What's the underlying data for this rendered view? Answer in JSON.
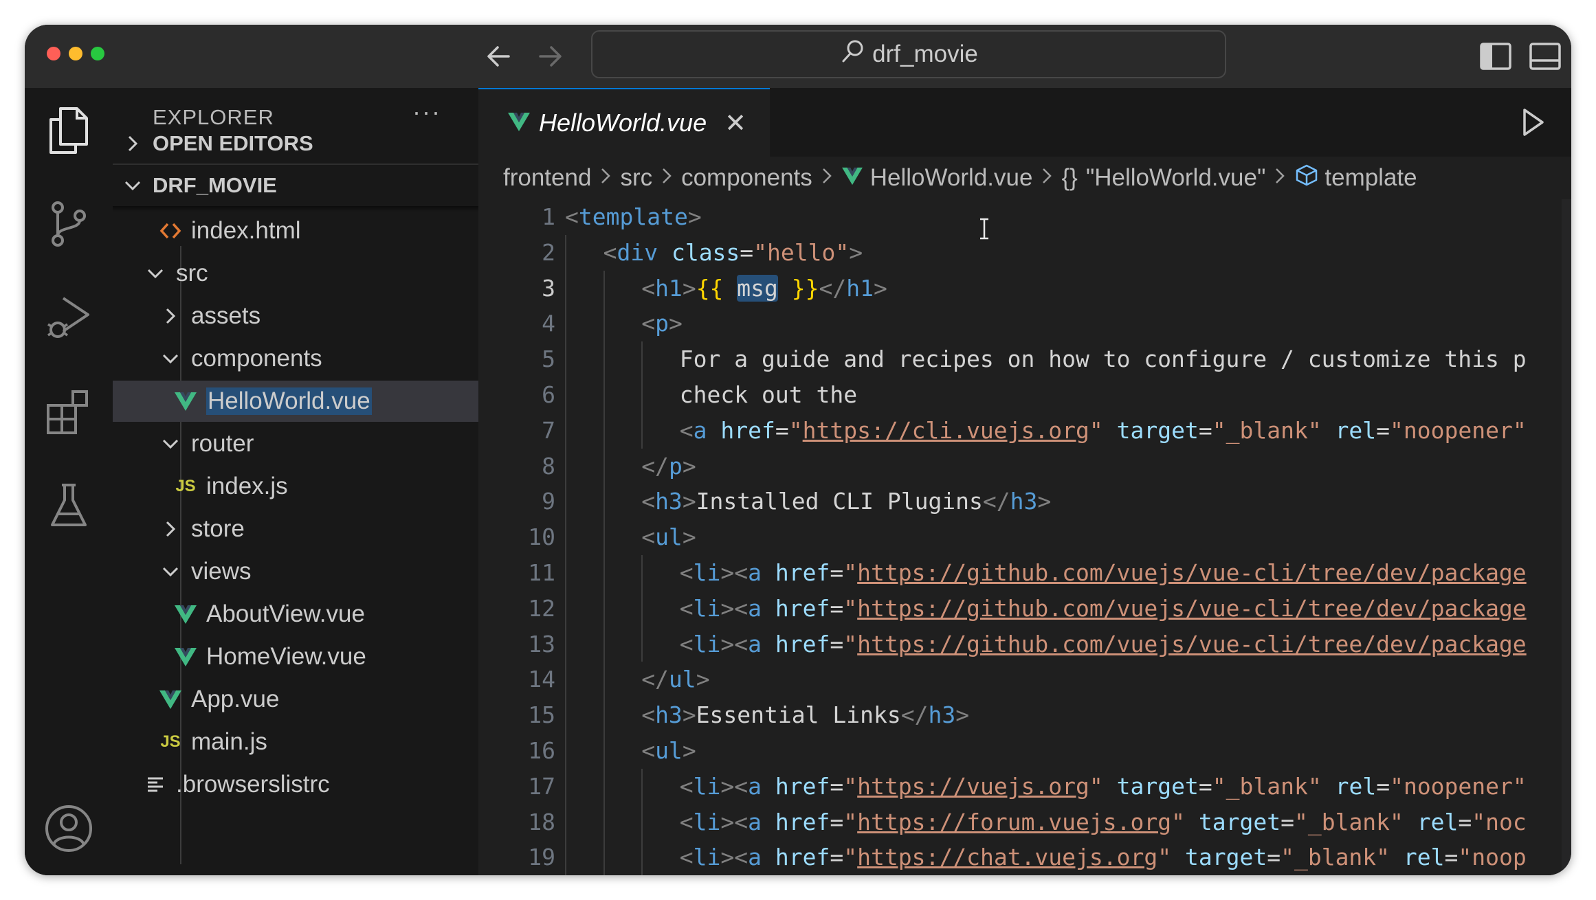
{
  "titlebar": {
    "search_text": "drf_movie"
  },
  "colors": {
    "accent": "#0078d4",
    "vue_green": "#41b883",
    "js_yellow": "#cbcb41",
    "html_orange": "#e37933",
    "selection": "#264f78"
  },
  "sidebar": {
    "title": "EXPLORER",
    "more": "···",
    "sections": [
      {
        "label": "OPEN EDITORS",
        "expanded": false
      },
      {
        "label": "DRF_MOVIE",
        "expanded": true
      }
    ],
    "tree": [
      {
        "label": "index.html",
        "icon": "html-file-icon"
      },
      {
        "label": "src",
        "icon": "chevron-down-icon"
      },
      {
        "label": "assets",
        "icon": "chevron-right-icon"
      },
      {
        "label": "components",
        "icon": "chevron-down-icon"
      },
      {
        "label": "HelloWorld.vue",
        "icon": "vue-file-icon",
        "selected": true
      },
      {
        "label": "router",
        "icon": "chevron-down-icon"
      },
      {
        "label": "index.js",
        "icon": "js-file-icon"
      },
      {
        "label": "store",
        "icon": "chevron-right-icon"
      },
      {
        "label": "views",
        "icon": "chevron-down-icon"
      },
      {
        "label": "AboutView.vue",
        "icon": "vue-file-icon"
      },
      {
        "label": "HomeView.vue",
        "icon": "vue-file-icon"
      },
      {
        "label": "App.vue",
        "icon": "vue-file-icon"
      },
      {
        "label": "main.js",
        "icon": "js-file-icon"
      },
      {
        "label": ".browserslistrc",
        "icon": "lines-file-icon"
      }
    ],
    "js_badge": "JS"
  },
  "tab": {
    "label": "HelloWorld.vue",
    "close": "✕"
  },
  "breadcrumbs": [
    "frontend",
    "src",
    "components",
    "HelloWorld.vue",
    "\"HelloWorld.vue\"",
    "template"
  ],
  "breadcrumb_braces": "{}",
  "active_line": 3,
  "code_lines": [
    {
      "n": "1",
      "t": [
        [
          "br",
          "<"
        ],
        [
          "t",
          "template"
        ],
        [
          "br",
          ">"
        ]
      ]
    },
    {
      "n": "2",
      "t": [
        [
          "br",
          "<"
        ],
        [
          "t",
          "div"
        ],
        [
          "p",
          " "
        ],
        [
          "a",
          "class"
        ],
        [
          "p",
          "="
        ],
        [
          "s",
          "\"hello\""
        ],
        [
          "br",
          ">"
        ]
      ]
    },
    {
      "n": "3",
      "t": [
        [
          "br",
          "<"
        ],
        [
          "t",
          "h1"
        ],
        [
          "br",
          ">"
        ],
        [
          "m",
          "{{ "
        ],
        [
          "hl",
          "msg"
        ],
        [
          "m",
          " }}"
        ],
        [
          "br",
          "</"
        ],
        [
          "t",
          "h1"
        ],
        [
          "br",
          ">"
        ]
      ]
    },
    {
      "n": "4",
      "t": [
        [
          "br",
          "<"
        ],
        [
          "t",
          "p"
        ],
        [
          "br",
          ">"
        ]
      ]
    },
    {
      "n": "5",
      "t": [
        [
          "p",
          "For a guide and recipes on how to configure / customize this p"
        ]
      ]
    },
    {
      "n": "6",
      "t": [
        [
          "p",
          "check out the"
        ]
      ]
    },
    {
      "n": "7",
      "t": [
        [
          "br",
          "<"
        ],
        [
          "t",
          "a"
        ],
        [
          "p",
          " "
        ],
        [
          "a",
          "href"
        ],
        [
          "p",
          "="
        ],
        [
          "s",
          "\""
        ],
        [
          "u",
          "https://cli.vuejs.org"
        ],
        [
          "s",
          "\""
        ],
        [
          "p",
          " "
        ],
        [
          "a",
          "target"
        ],
        [
          "p",
          "="
        ],
        [
          "s",
          "\"_blank\""
        ],
        [
          "p",
          " "
        ],
        [
          "a",
          "rel"
        ],
        [
          "p",
          "="
        ],
        [
          "s",
          "\"noopener\""
        ]
      ]
    },
    {
      "n": "8",
      "t": [
        [
          "br",
          "</"
        ],
        [
          "t",
          "p"
        ],
        [
          "br",
          ">"
        ]
      ]
    },
    {
      "n": "9",
      "t": [
        [
          "br",
          "<"
        ],
        [
          "t",
          "h3"
        ],
        [
          "br",
          ">"
        ],
        [
          "p",
          "Installed CLI Plugins"
        ],
        [
          "br",
          "</"
        ],
        [
          "t",
          "h3"
        ],
        [
          "br",
          ">"
        ]
      ]
    },
    {
      "n": "10",
      "t": [
        [
          "br",
          "<"
        ],
        [
          "t",
          "ul"
        ],
        [
          "br",
          ">"
        ]
      ]
    },
    {
      "n": "11",
      "t": [
        [
          "br",
          "<"
        ],
        [
          "t",
          "li"
        ],
        [
          "br",
          "><"
        ],
        [
          "t",
          "a"
        ],
        [
          "p",
          " "
        ],
        [
          "a",
          "href"
        ],
        [
          "p",
          "="
        ],
        [
          "s",
          "\""
        ],
        [
          "u",
          "https://github.com/vuejs/vue-cli/tree/dev/package"
        ]
      ]
    },
    {
      "n": "12",
      "t": [
        [
          "br",
          "<"
        ],
        [
          "t",
          "li"
        ],
        [
          "br",
          "><"
        ],
        [
          "t",
          "a"
        ],
        [
          "p",
          " "
        ],
        [
          "a",
          "href"
        ],
        [
          "p",
          "="
        ],
        [
          "s",
          "\""
        ],
        [
          "u",
          "https://github.com/vuejs/vue-cli/tree/dev/package"
        ]
      ]
    },
    {
      "n": "13",
      "t": [
        [
          "br",
          "<"
        ],
        [
          "t",
          "li"
        ],
        [
          "br",
          "><"
        ],
        [
          "t",
          "a"
        ],
        [
          "p",
          " "
        ],
        [
          "a",
          "href"
        ],
        [
          "p",
          "="
        ],
        [
          "s",
          "\""
        ],
        [
          "u",
          "https://github.com/vuejs/vue-cli/tree/dev/package"
        ]
      ]
    },
    {
      "n": "14",
      "t": [
        [
          "br",
          "</"
        ],
        [
          "t",
          "ul"
        ],
        [
          "br",
          ">"
        ]
      ]
    },
    {
      "n": "15",
      "t": [
        [
          "br",
          "<"
        ],
        [
          "t",
          "h3"
        ],
        [
          "br",
          ">"
        ],
        [
          "p",
          "Essential Links"
        ],
        [
          "br",
          "</"
        ],
        [
          "t",
          "h3"
        ],
        [
          "br",
          ">"
        ]
      ]
    },
    {
      "n": "16",
      "t": [
        [
          "br",
          "<"
        ],
        [
          "t",
          "ul"
        ],
        [
          "br",
          ">"
        ]
      ]
    },
    {
      "n": "17",
      "t": [
        [
          "br",
          "<"
        ],
        [
          "t",
          "li"
        ],
        [
          "br",
          "><"
        ],
        [
          "t",
          "a"
        ],
        [
          "p",
          " "
        ],
        [
          "a",
          "href"
        ],
        [
          "p",
          "="
        ],
        [
          "s",
          "\""
        ],
        [
          "u",
          "https://vuejs.org"
        ],
        [
          "s",
          "\""
        ],
        [
          "p",
          " "
        ],
        [
          "a",
          "target"
        ],
        [
          "p",
          "="
        ],
        [
          "s",
          "\"_blank\""
        ],
        [
          "p",
          " "
        ],
        [
          "a",
          "rel"
        ],
        [
          "p",
          "="
        ],
        [
          "s",
          "\"noopener\""
        ]
      ]
    },
    {
      "n": "18",
      "t": [
        [
          "br",
          "<"
        ],
        [
          "t",
          "li"
        ],
        [
          "br",
          "><"
        ],
        [
          "t",
          "a"
        ],
        [
          "p",
          " "
        ],
        [
          "a",
          "href"
        ],
        [
          "p",
          "="
        ],
        [
          "s",
          "\""
        ],
        [
          "u",
          "https://forum.vuejs.org"
        ],
        [
          "s",
          "\""
        ],
        [
          "p",
          " "
        ],
        [
          "a",
          "target"
        ],
        [
          "p",
          "="
        ],
        [
          "s",
          "\"_blank\""
        ],
        [
          "p",
          " "
        ],
        [
          "a",
          "rel"
        ],
        [
          "p",
          "="
        ],
        [
          "s",
          "\"noc"
        ]
      ]
    },
    {
      "n": "19",
      "t": [
        [
          "br",
          "<"
        ],
        [
          "t",
          "li"
        ],
        [
          "br",
          "><"
        ],
        [
          "t",
          "a"
        ],
        [
          "p",
          " "
        ],
        [
          "a",
          "href"
        ],
        [
          "p",
          "="
        ],
        [
          "s",
          "\""
        ],
        [
          "u",
          "https://chat.vuejs.org"
        ],
        [
          "s",
          "\""
        ],
        [
          "p",
          " "
        ],
        [
          "a",
          "target"
        ],
        [
          "p",
          "="
        ],
        [
          "s",
          "\"_blank\""
        ],
        [
          "p",
          " "
        ],
        [
          "a",
          "rel"
        ],
        [
          "p",
          "="
        ],
        [
          "s",
          "\"noop"
        ]
      ]
    }
  ]
}
